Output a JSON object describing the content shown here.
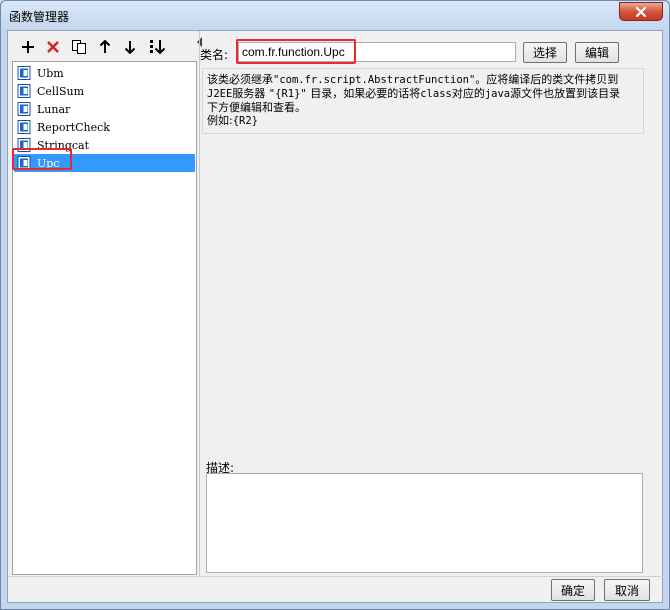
{
  "window": {
    "title": "函数管理器"
  },
  "toolbar": {
    "add_icon": "plus-icon",
    "delete_icon": "red-x-icon",
    "copy_icon": "copy-icon",
    "move_up_icon": "arrow-up-icon",
    "move_down_icon": "arrow-down-icon",
    "sort_icon": "sort-down-icon"
  },
  "functions": {
    "items": [
      {
        "label": "Ubm",
        "selected": false
      },
      {
        "label": "CellSum",
        "selected": false
      },
      {
        "label": "Lunar",
        "selected": false
      },
      {
        "label": "ReportCheck",
        "selected": false
      },
      {
        "label": "Stringcat",
        "selected": false
      },
      {
        "label": "Upc",
        "selected": true
      }
    ]
  },
  "class_field": {
    "label": "类名:",
    "value": "com.fr.function.Upc",
    "select_button": "选择",
    "edit_button": "编辑"
  },
  "hint": {
    "line1_a": "该类必须继承",
    "line1_code": "\"com.fr.script.AbstractFunction\"",
    "line1_b": "。应将编译后的类文件拷贝到",
    "line2_a": "J2EE",
    "line2_b": "服务器 ",
    "line2_code": "\"{R1}\"",
    "line2_c": " 目录，如果必要的话将",
    "line2_d": "class",
    "line2_e": "对应的",
    "line2_f": "java",
    "line2_g": "源文件也放置到该目录",
    "line3": "下方便编辑和查看。",
    "line4_a": "例如:",
    "line4_code": "{R2}"
  },
  "description": {
    "label": "描述:",
    "value": ""
  },
  "footer": {
    "ok_button": "确定",
    "cancel_button": "取消"
  },
  "colors": {
    "selection": "#3399ff",
    "highlight_red": "#e8292e",
    "close_red": "#c13a20"
  }
}
